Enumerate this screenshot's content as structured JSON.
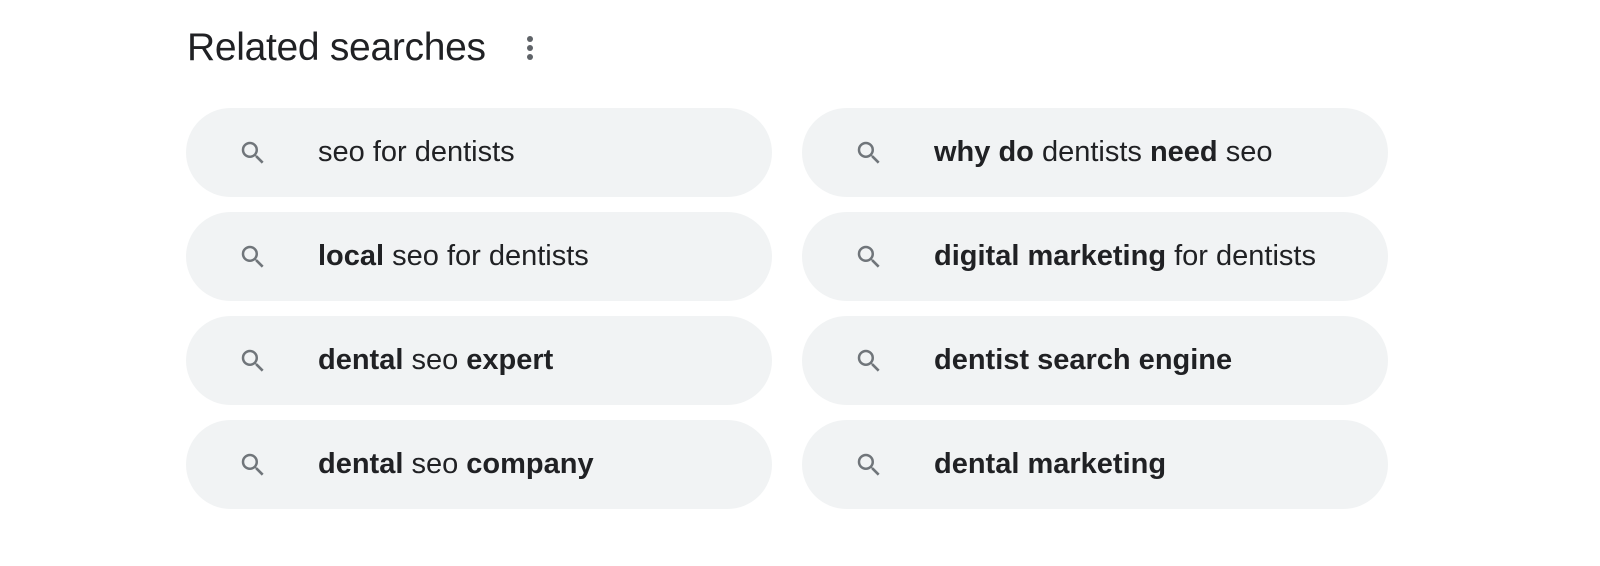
{
  "header": {
    "title": "Related searches",
    "more_icon": "more-vert-icon"
  },
  "icons": {
    "chip_icon": "search-icon"
  },
  "colors": {
    "chip_background": "#f1f3f4",
    "text": "#202124",
    "icon": "#70757a"
  },
  "related_searches": [
    {
      "segments": [
        {
          "text": "seo for dentists",
          "bold": false
        }
      ]
    },
    {
      "segments": [
        {
          "text": "why do",
          "bold": true
        },
        {
          "text": " dentists ",
          "bold": false
        },
        {
          "text": "need",
          "bold": true
        },
        {
          "text": " seo",
          "bold": false
        }
      ]
    },
    {
      "segments": [
        {
          "text": "local",
          "bold": true
        },
        {
          "text": " seo for dentists",
          "bold": false
        }
      ]
    },
    {
      "segments": [
        {
          "text": "digital marketing",
          "bold": true
        },
        {
          "text": " for dentists",
          "bold": false
        }
      ]
    },
    {
      "segments": [
        {
          "text": "dental",
          "bold": true
        },
        {
          "text": " seo ",
          "bold": false
        },
        {
          "text": "expert",
          "bold": true
        }
      ]
    },
    {
      "segments": [
        {
          "text": "dentist search engine",
          "bold": true
        }
      ]
    },
    {
      "segments": [
        {
          "text": "dental",
          "bold": true
        },
        {
          "text": " seo ",
          "bold": false
        },
        {
          "text": "company",
          "bold": true
        }
      ]
    },
    {
      "segments": [
        {
          "text": "dental marketing",
          "bold": true
        }
      ]
    }
  ]
}
